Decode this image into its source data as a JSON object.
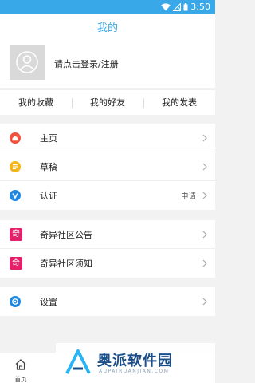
{
  "status_bar": {
    "time": "3:50"
  },
  "header": {
    "title": "我的"
  },
  "profile": {
    "login_prompt": "请点击登录/注册"
  },
  "quick_tabs": [
    {
      "label": "我的收藏"
    },
    {
      "label": "我的好友"
    },
    {
      "label": "我的发表"
    }
  ],
  "menu_group_1": [
    {
      "label": "主页",
      "icon": "home-icon",
      "icon_color": "#f0503c"
    },
    {
      "label": "草稿",
      "icon": "draft-icon",
      "icon_color": "#f3b51c"
    },
    {
      "label": "认证",
      "icon": "verify-icon",
      "icon_color": "#1e88e5",
      "extra": "申请"
    }
  ],
  "menu_group_2": [
    {
      "label": "奇异社区公告",
      "icon": "community-icon",
      "icon_glyph": "奇",
      "icon_color": "#e5206a"
    },
    {
      "label": "奇异社区须知",
      "icon": "community-icon",
      "icon_glyph": "奇",
      "icon_color": "#e5206a"
    }
  ],
  "menu_group_3": [
    {
      "label": "设置",
      "icon": "settings-icon",
      "icon_color": "#1e88e5"
    }
  ],
  "tabbar": {
    "home_label": "首页"
  },
  "watermark": {
    "name": "奥派软件园",
    "sub": "AUPAIRUANJIAN.COM"
  },
  "colors": {
    "accent": "#39a8e8",
    "background": "#f2f2f2"
  }
}
